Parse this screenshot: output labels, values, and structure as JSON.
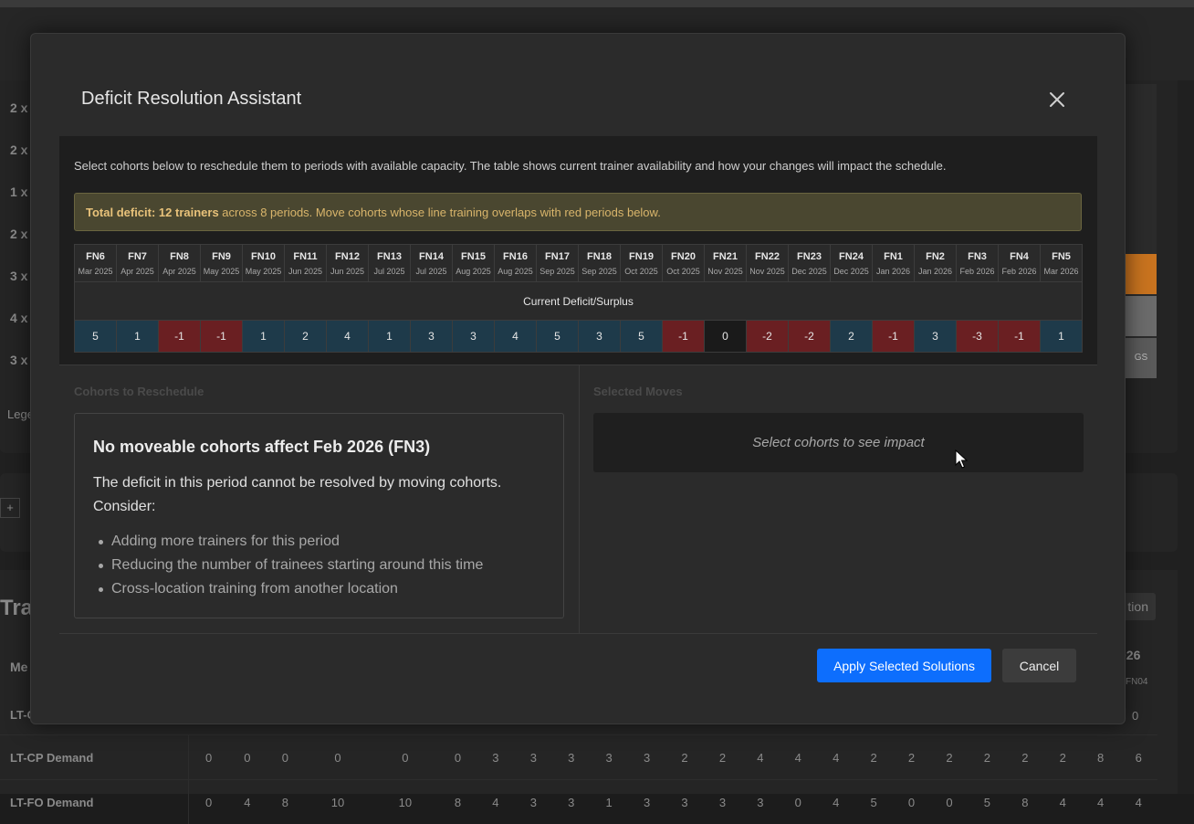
{
  "modal": {
    "title": "Deficit Resolution Assistant",
    "intro": "Select cohorts below to reschedule them to periods with available capacity. The table shows current trainer availability and how your changes will impact the schedule.",
    "alert": {
      "bold": "Total deficit: 12 trainers",
      "rest": " across 8 periods. Move cohorts whose line training overlaps with red periods below."
    },
    "table_caption": "Current Deficit/Surplus",
    "periods": [
      {
        "fn": "FN6",
        "month": "Mar 2025",
        "value": 5
      },
      {
        "fn": "FN7",
        "month": "Apr 2025",
        "value": 1
      },
      {
        "fn": "FN8",
        "month": "Apr 2025",
        "value": -1
      },
      {
        "fn": "FN9",
        "month": "May 2025",
        "value": -1
      },
      {
        "fn": "FN10",
        "month": "May 2025",
        "value": 1
      },
      {
        "fn": "FN11",
        "month": "Jun 2025",
        "value": 2
      },
      {
        "fn": "FN12",
        "month": "Jun 2025",
        "value": 4
      },
      {
        "fn": "FN13",
        "month": "Jul 2025",
        "value": 1
      },
      {
        "fn": "FN14",
        "month": "Jul 2025",
        "value": 3
      },
      {
        "fn": "FN15",
        "month": "Aug 2025",
        "value": 3
      },
      {
        "fn": "FN16",
        "month": "Aug 2025",
        "value": 4
      },
      {
        "fn": "FN17",
        "month": "Sep 2025",
        "value": 5
      },
      {
        "fn": "FN18",
        "month": "Sep 2025",
        "value": 3
      },
      {
        "fn": "FN19",
        "month": "Oct 2025",
        "value": 5
      },
      {
        "fn": "FN20",
        "month": "Oct 2025",
        "value": -1
      },
      {
        "fn": "FN21",
        "month": "Nov 2025",
        "value": 0
      },
      {
        "fn": "FN22",
        "month": "Nov 2025",
        "value": -2
      },
      {
        "fn": "FN23",
        "month": "Dec 2025",
        "value": -2
      },
      {
        "fn": "FN24",
        "month": "Dec 2025",
        "value": 2
      },
      {
        "fn": "FN1",
        "month": "Jan 2026",
        "value": -1
      },
      {
        "fn": "FN2",
        "month": "Jan 2026",
        "value": 3
      },
      {
        "fn": "FN3",
        "month": "Feb 2026",
        "value": -3
      },
      {
        "fn": "FN4",
        "month": "Feb 2026",
        "value": -1
      },
      {
        "fn": "FN5",
        "month": "Mar 2026",
        "value": 1
      }
    ],
    "cohorts_label": "Cohorts to Reschedule",
    "moves_label": "Selected Moves",
    "no_move": {
      "title": "No moveable cohorts affect Feb 2026 (FN3)",
      "text": "The deficit in this period cannot be resolved by moving cohorts. Consider:",
      "options": [
        "Adding more trainers for this period",
        "Reducing the number of trainees starting around this time",
        "Cross-location training from another location"
      ]
    },
    "impact_placeholder": "Select cohorts to see impact",
    "apply_label": "Apply Selected Solutions",
    "cancel_label": "Cancel",
    "colors": {
      "surplus": "#1e3a4a",
      "deficit": "#6a1f22",
      "zero": "#1a1a1a",
      "primary": "#0d6efd"
    }
  },
  "background": {
    "row_labels": [
      "2 x",
      "2 x",
      "1 x",
      "2 x",
      "3 x",
      "4 x",
      "3 x"
    ],
    "legend": "Lege",
    "gs_label": "GS",
    "section_title": "Tra",
    "button_text": "tion",
    "metric_label": "Me",
    "year_label": "026",
    "fn_label": "FN04",
    "lt_label": "LT-C",
    "lt_value": "0",
    "rows": [
      {
        "label": "LT-CP Demand",
        "values": [
          "0",
          "0",
          "0",
          "0",
          "0",
          "0",
          "3",
          "3",
          "3",
          "3",
          "3",
          "2",
          "2",
          "4",
          "4",
          "4",
          "2",
          "2",
          "2",
          "2",
          "2",
          "2",
          "8",
          "6"
        ]
      },
      {
        "label": "LT-FO Demand",
        "values": [
          "0",
          "4",
          "8",
          "10",
          "10",
          "8",
          "4",
          "3",
          "3",
          "1",
          "3",
          "3",
          "3",
          "3",
          "0",
          "4",
          "5",
          "0",
          "0",
          "5",
          "8",
          "4",
          "4",
          "4"
        ]
      }
    ]
  }
}
